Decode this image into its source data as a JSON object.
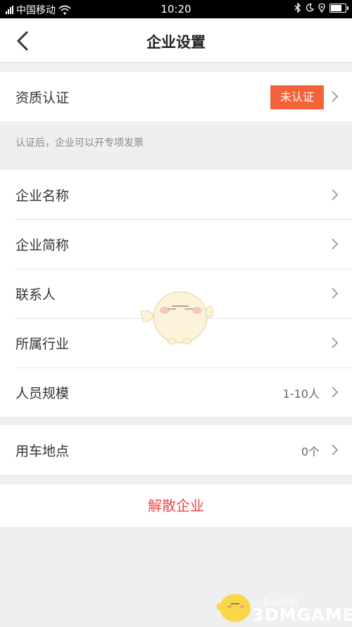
{
  "status_bar": {
    "carrier": "中国移动",
    "time": "10:20"
  },
  "nav": {
    "title": "企业设置"
  },
  "qualification": {
    "label": "资质认证",
    "badge": "未认证",
    "badge_color": "#f4623a"
  },
  "hint": "认证后，企业可以开专项发票",
  "info_rows": [
    {
      "label": "企业名称",
      "value": ""
    },
    {
      "label": "企业简称",
      "value": ""
    },
    {
      "label": "联系人",
      "value": ""
    },
    {
      "label": "所属行业",
      "value": ""
    },
    {
      "label": "人员规模",
      "value": "1-10人"
    }
  ],
  "location": {
    "label": "用车地点",
    "value": "0个"
  },
  "dissolve": {
    "label": "解散企业",
    "color": "#f0484a"
  },
  "watermark": {
    "text": "3DMGAME",
    "sub": "Bai经验"
  }
}
